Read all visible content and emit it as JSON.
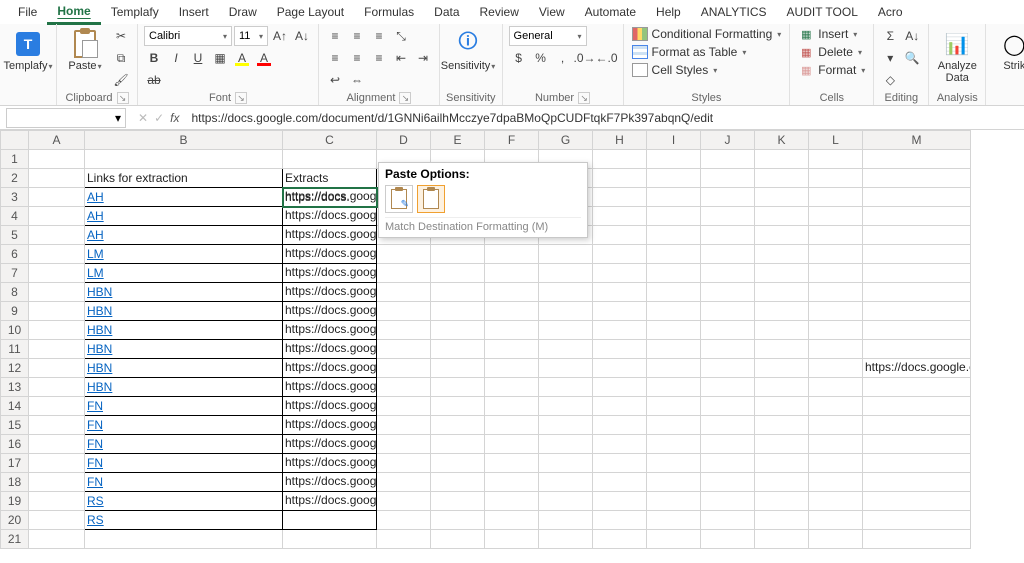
{
  "tabs": [
    "File",
    "Home",
    "Templafy",
    "Insert",
    "Draw",
    "Page Layout",
    "Formulas",
    "Data",
    "Review",
    "View",
    "Automate",
    "Help",
    "ANALYTICS",
    "AUDIT TOOL",
    "Acro"
  ],
  "active_tab": "Home",
  "ribbon": {
    "templafy": {
      "label": "Templafy"
    },
    "clipboard": {
      "paste": "Paste",
      "group": "Clipboard"
    },
    "font": {
      "group": "Font",
      "name": "Calibri",
      "size": "11",
      "bold": "B",
      "italic": "I",
      "underline": "U"
    },
    "alignment": {
      "group": "Alignment"
    },
    "sensitivity": {
      "label": "Sensitivity",
      "group": "Sensitivity"
    },
    "number": {
      "group": "Number",
      "format": "General"
    },
    "styles": {
      "group": "Styles",
      "cond": "Conditional Formatting",
      "table": "Format as Table",
      "cell": "Cell Styles"
    },
    "cells": {
      "group": "Cells",
      "insert": "Insert",
      "delete": "Delete",
      "format": "Format"
    },
    "editing": {
      "group": "Editing"
    },
    "analysis": {
      "group": "Analysis",
      "analyze": "Analyze\nData"
    },
    "strike": "Strik"
  },
  "name_box": "",
  "formula": "https://docs.google.com/document/d/1GNNi6ailhMcczye7dpaBMoQpCUDFtqkF7Pk397abqnQ/edit",
  "columns": [
    "A",
    "B",
    "C",
    "D",
    "E",
    "F",
    "G",
    "H",
    "I",
    "J",
    "K",
    "L",
    "M"
  ],
  "headers": {
    "B1": "Links for extraction",
    "C1": "Extracts"
  },
  "rows": [
    {
      "n": 1
    },
    {
      "n": 2,
      "b": "",
      "c": ""
    },
    {
      "n": 3,
      "b": "AH",
      "c": "https://docs.",
      "url": "https://docs.google.com/document/d/1GNNi6ailhMcczye7dpaBMoQpCUDFtqkF7Pk397abqnQ/edit"
    },
    {
      "n": 4,
      "b": "AH",
      "c": "https://docs.g",
      "url": "https://docs.google.com/document/d/1GNNi6ailhMcczye7dpaBMoQpCUDFtqkF7Pk397abqnQ/edit"
    },
    {
      "n": 5,
      "b": "AH",
      "c": "",
      "url": "https://docs.google.com/document/d/1GNNi6ailhMcczye7dpaBMoQpCUDFtqkF7Pk397abqnQ/edit"
    },
    {
      "n": 6,
      "b": "LM",
      "c": "https://docs.googl",
      "url": "https://docs.google.com/document/d/1GNNi6ailhMcczye7dpaBMoQpCUDFtqkF7Pk397abqnQ/edit"
    },
    {
      "n": 7,
      "b": "LM",
      "c": "",
      "url": "https://docs.google.com/document/d/1GNNi6ailhMcczye7dpaBMoQpCUDFtqkF7Pk397abqnQ/edit"
    },
    {
      "n": 8,
      "b": "HBN",
      "c": "",
      "url": "https://docs.google.com/document/d/1GNNi6ailhMcczye7dpaBMoQpCUDFtqkF7Pk397abqnQ/edit"
    },
    {
      "n": 9,
      "b": "HBN",
      "c": "",
      "url": "https://docs.google.com/document/d/1GNNi6ailhMcczye7dpaBMoQpCUDFtqkF7Pk397abqnQ/edit"
    },
    {
      "n": 10,
      "b": "HBN",
      "c": "",
      "url": "https://docs.google.com/document/d/1GNNi6ailhMcczye7dpaBMoQpCUDFtqkF7Pk397abqnQ/edit"
    },
    {
      "n": 11,
      "b": "HBN",
      "c": "",
      "url": "https://docs.google.com/document/d/1GNNi6ailhMcczye7dpaBMoQpCUDFtqkF7Pk397abqnQ/edit"
    },
    {
      "n": 12,
      "b": "HBN",
      "c": "",
      "url": "https://docs.google.com/document/d/1GNNi6ailhMcczye7dpaBMoQpCUDFtqkF7Pk397abqnQ/edit",
      "m": "https://docs.google.com"
    },
    {
      "n": 13,
      "b": "HBN",
      "c": "",
      "url": "https://docs.google.com/document/d/1GNNi6ailhMcczye7dpaBMoQpCUDFtqkF7Pk397abqnQ/edit"
    },
    {
      "n": 14,
      "b": "FN",
      "c": "",
      "url": "https://docs.google.com/document/d/1GNNi6ailhMcczye7dpaBMoQpCUDFtqkF7Pk397abqnQ/edit"
    },
    {
      "n": 15,
      "b": "FN",
      "c": "",
      "url": "https://docs.google.com/document/d/1GNNi6ailhMcczye7dpaBMoQpCUDFtqkF7Pk397abqnQ/edit"
    },
    {
      "n": 16,
      "b": "FN",
      "c": "",
      "url": "https://docs.google.com/document/d/1GNNi6ailhMcczye7dpaBMoQpCUDFtqkF7Pk397abqnQ/edit"
    },
    {
      "n": 17,
      "b": "FN",
      "c": "",
      "url": "https://docs.google.com/document/d/1GNNi6ailhMcczye7dpaBMoQpCUDFtqkF7Pk397abqnQ/edit"
    },
    {
      "n": 18,
      "b": "FN",
      "c": "",
      "url": "  https://docs.google.com/document/d/1GNNi6ailhMcczye7dpaBMoQpCUDFtqkF7Pk397abqnQ/edit"
    },
    {
      "n": 19,
      "b": "RS",
      "c": "",
      "url": "https://docs.google.com/document/d/1GNNi6ailhMcczye7dpaBMoQpCUDFtqkF7Pk397abqnQ/edit"
    },
    {
      "n": 20,
      "b": "RS",
      "c": ""
    },
    {
      "n": 21
    }
  ],
  "paste_popup": {
    "title": "Paste Options:",
    "hint": "Match Destination Formatting (M)"
  }
}
